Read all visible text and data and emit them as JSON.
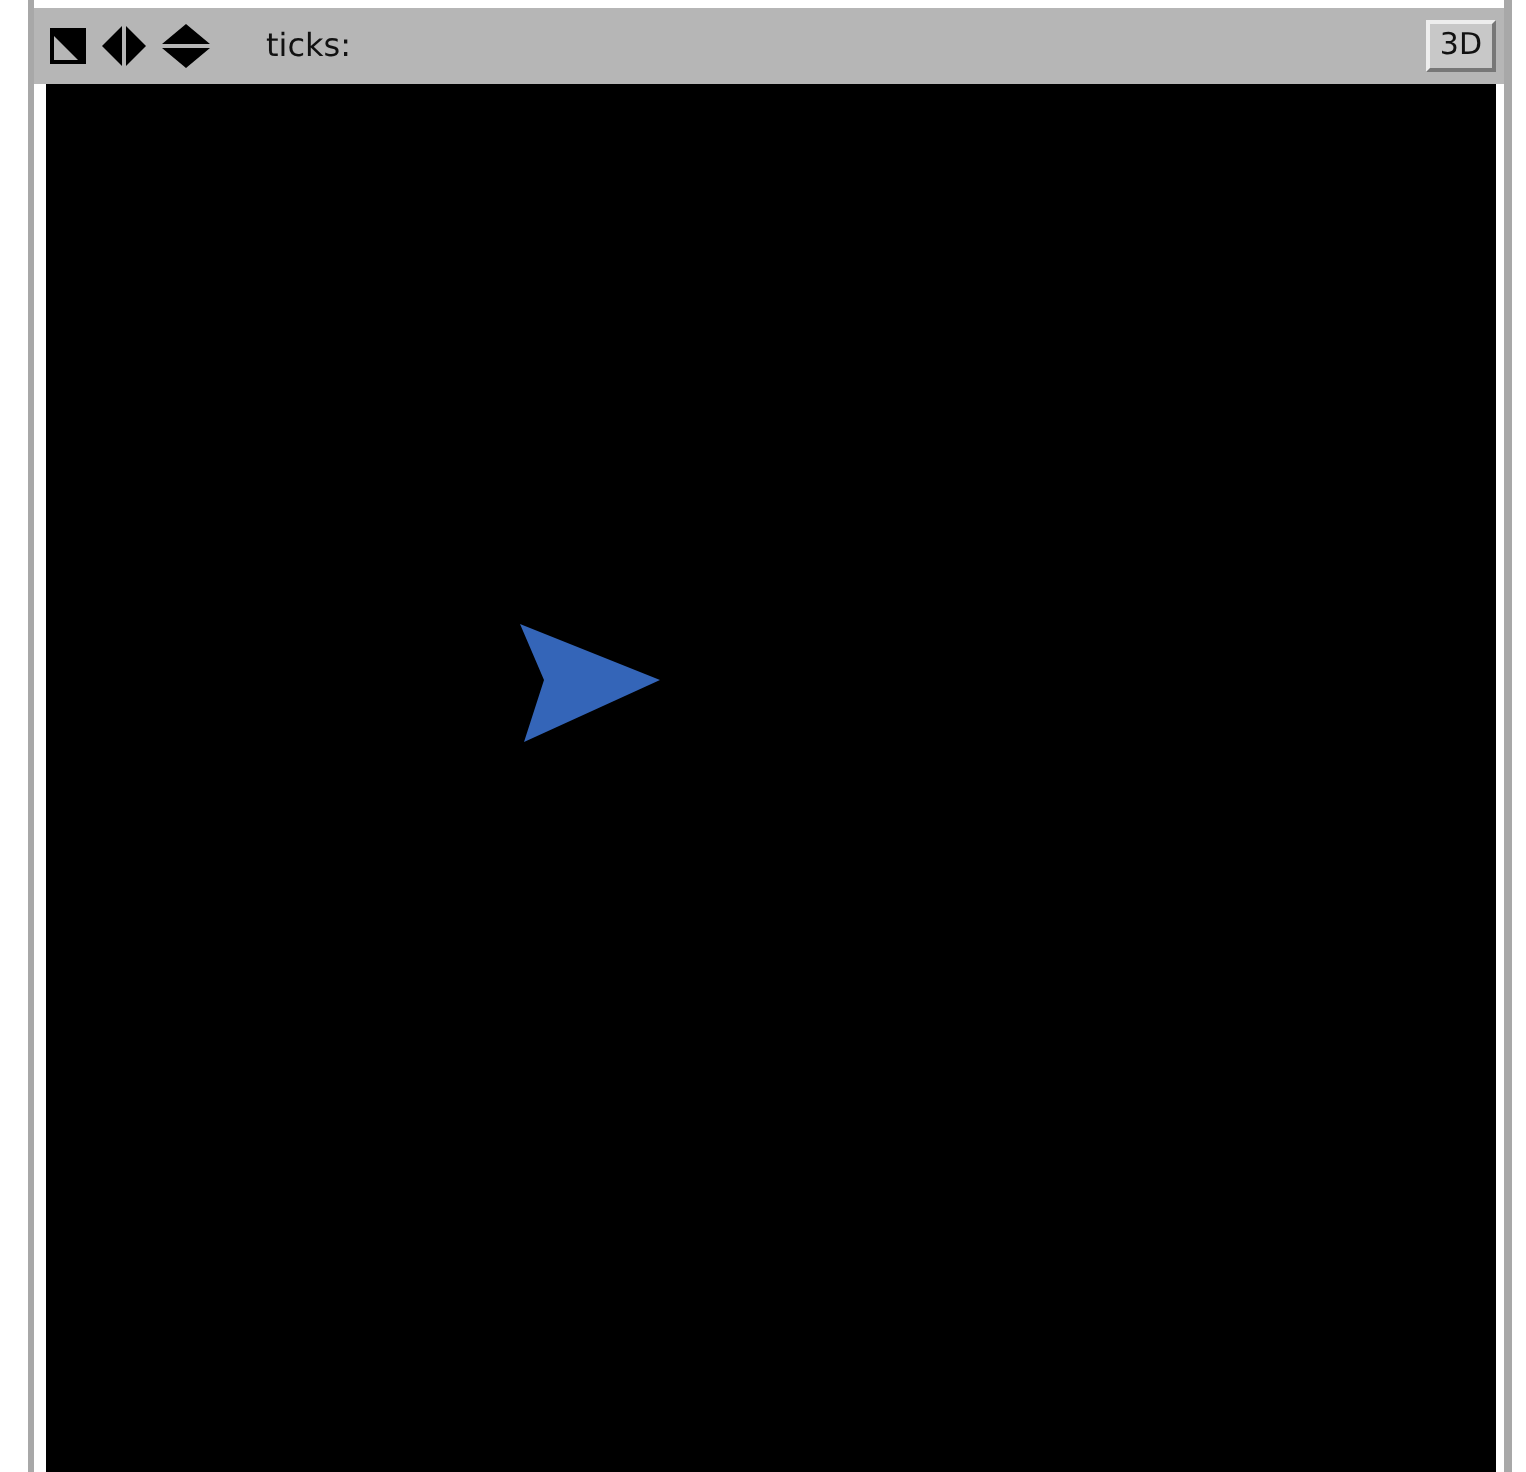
{
  "toolbar": {
    "ticks_label": "ticks:",
    "button": "3D"
  }
}
